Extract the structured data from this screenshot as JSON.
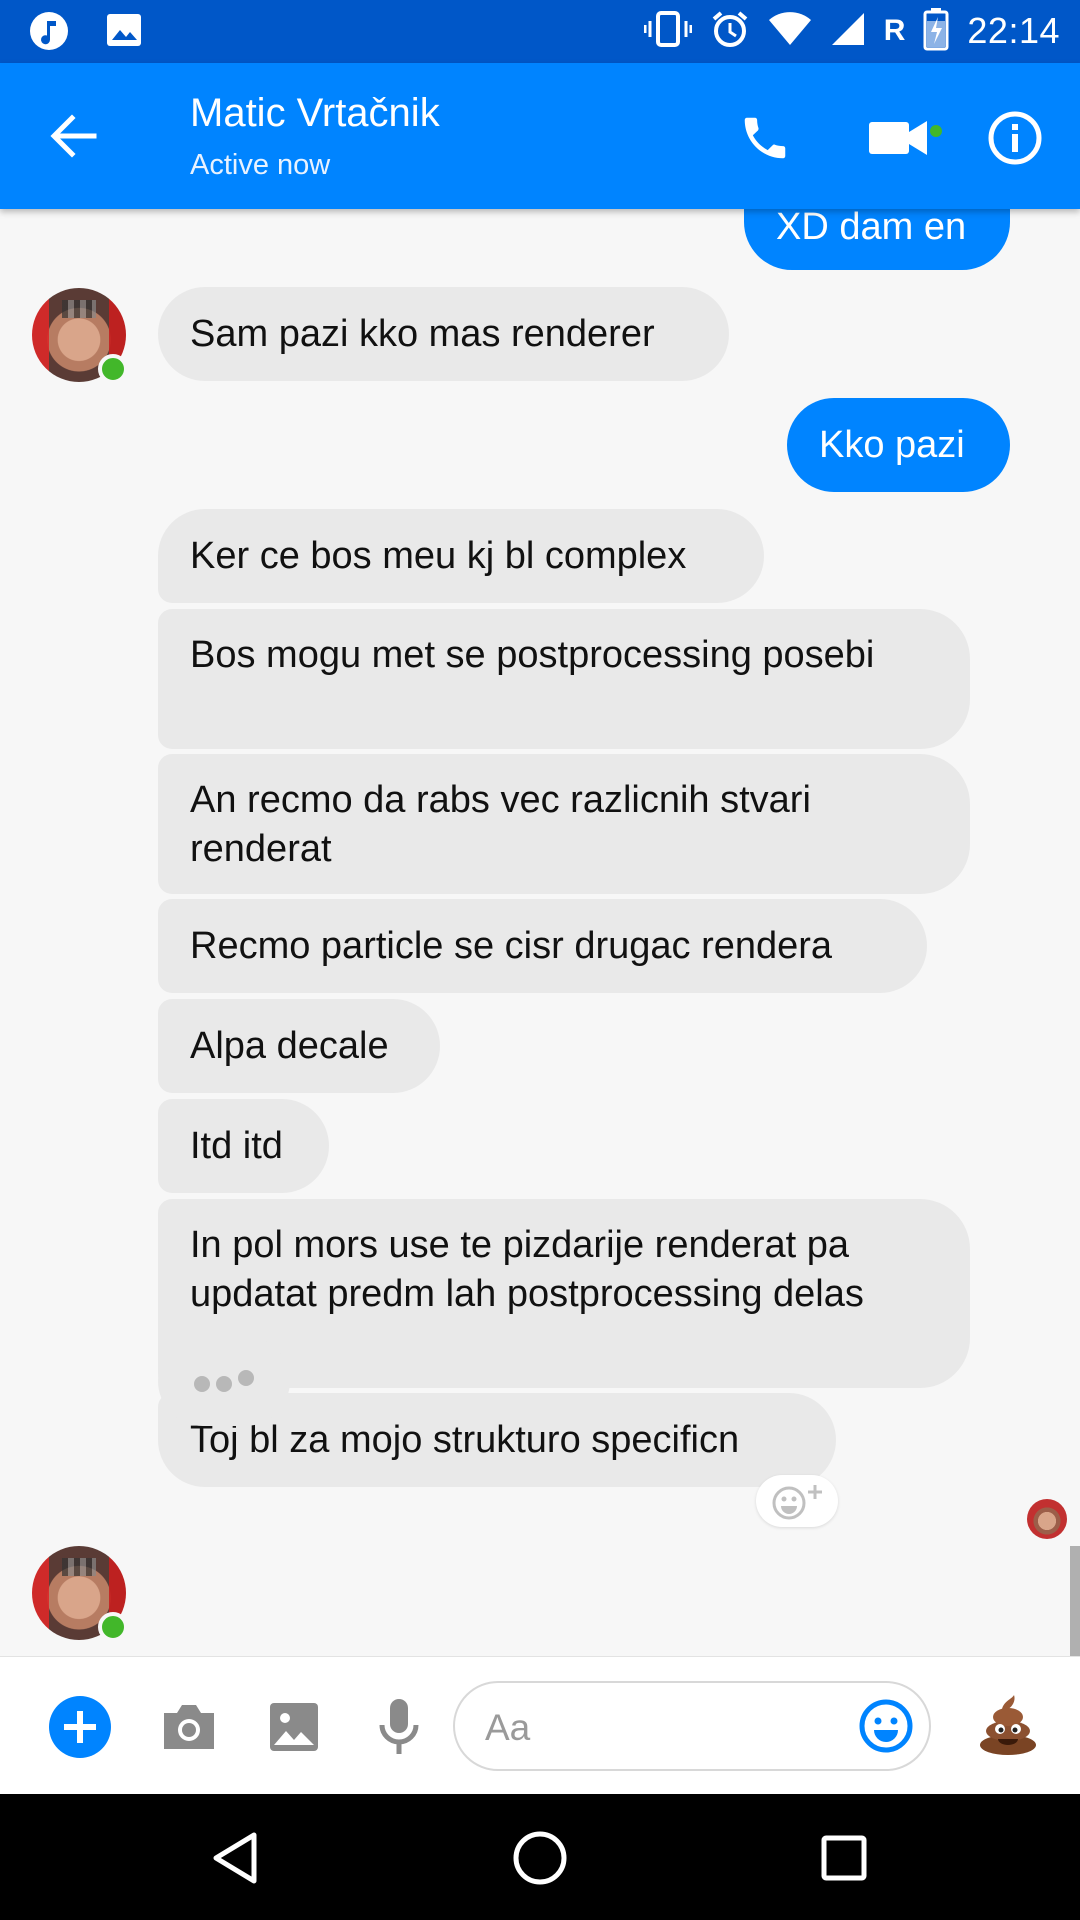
{
  "status_bar": {
    "time": "22:14",
    "roaming": "R",
    "icons": [
      "music-icon",
      "image-notification-icon",
      "vibrate-icon",
      "alarm-icon",
      "wifi-icon",
      "signal-icon",
      "battery-charging-icon"
    ]
  },
  "header": {
    "contact_name": "Matic Vrtačnik",
    "status": "Active now",
    "icons": [
      "back-arrow-icon",
      "phone-icon",
      "video-camera-icon",
      "info-icon"
    ]
  },
  "messages": [
    {
      "from": "me",
      "text": "XD dam en"
    },
    {
      "from": "contact",
      "text": "Sam pazi kko mas renderer"
    },
    {
      "from": "me",
      "text": "Kko pazi"
    },
    {
      "from": "contact",
      "text": "Ker ce bos meu kj bl complex"
    },
    {
      "from": "contact",
      "text": "Bos mogu met se postprocessing posebi"
    },
    {
      "from": "contact",
      "text": "An recmo da rabs vec razlicnih stvari renderat"
    },
    {
      "from": "contact",
      "text": "Recmo particle se cisr drugac rendera"
    },
    {
      "from": "contact",
      "text": "Alpa decale"
    },
    {
      "from": "contact",
      "text": "Itd itd"
    },
    {
      "from": "contact",
      "text": "In pol mors use te pizdarije renderat pa updatat predm lah postprocessing delas"
    },
    {
      "from": "contact",
      "text": "Toj bl za mojo strukturo specificn"
    }
  ],
  "composer": {
    "placeholder": "Aa",
    "icons": [
      "plus-icon",
      "camera-icon",
      "gallery-icon",
      "microphone-icon",
      "emoji-icon",
      "poop-emoji-icon"
    ]
  },
  "nav_bar": {
    "icons": [
      "back-triangle-icon",
      "home-circle-icon",
      "recents-square-icon"
    ]
  },
  "colors": {
    "status_bar": "#0057c8",
    "header": "#0084ff",
    "outgoing_bubble": "#0084ff",
    "incoming_bubble": "#e9e9e9",
    "online": "#42b72a"
  }
}
